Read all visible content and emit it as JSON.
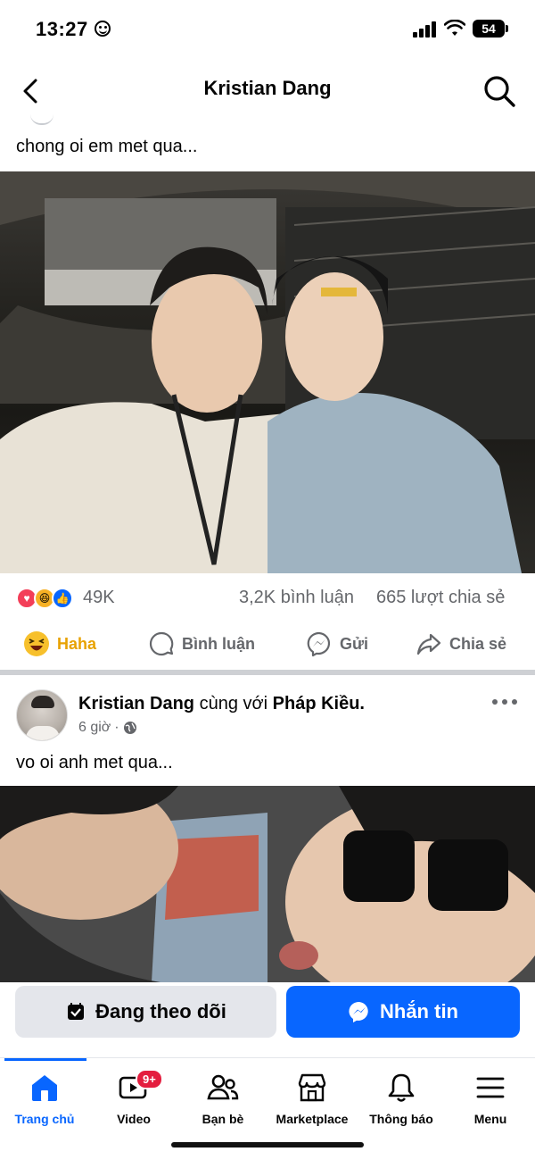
{
  "status": {
    "time": "13:27",
    "battery": "54"
  },
  "header": {
    "title": "Kristian Dang"
  },
  "post1": {
    "caption": "chong oi em met qua...",
    "reactions_count": "49K",
    "comments": "3,2K bình luận",
    "shares": "665 lượt chia sẻ",
    "actions": {
      "haha": "Haha",
      "comment": "Bình luận",
      "send": "Gửi",
      "share": "Chia sẻ"
    }
  },
  "post2": {
    "author": "Kristian Dang",
    "with_text": "cùng với",
    "tagged": "Pháp Kiều.",
    "time": "6 giờ",
    "dot": "·",
    "caption": "vo oi anh met qua..."
  },
  "buttons": {
    "following": "Đang theo dõi",
    "message": "Nhắn tin"
  },
  "tabs": [
    {
      "label": "Trang chủ",
      "icon": "home-icon"
    },
    {
      "label": "Video",
      "icon": "video-icon",
      "badge": "9+"
    },
    {
      "label": "Bạn bè",
      "icon": "friends-icon"
    },
    {
      "label": "Marketplace",
      "icon": "marketplace-icon"
    },
    {
      "label": "Thông báo",
      "icon": "bell-icon"
    },
    {
      "label": "Menu",
      "icon": "menu-icon"
    }
  ],
  "colors": {
    "accent": "#0866ff",
    "badge": "#e41e3f",
    "secondary_text": "#65676b"
  }
}
